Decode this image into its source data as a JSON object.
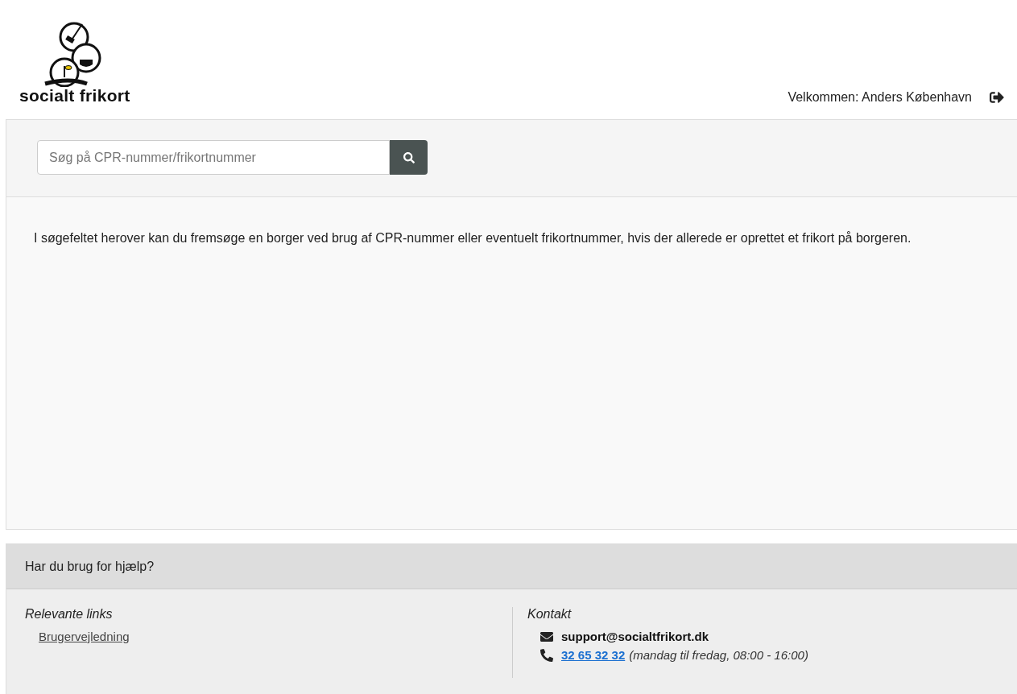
{
  "header": {
    "logo_text": "socialt frikort",
    "welcome": "Velkommen: Anders København"
  },
  "search": {
    "placeholder": "Søg på CPR-nummer/frikortnummer"
  },
  "intro": "I søgefeltet herover kan du fremsøge en borger ved brug af CPR-nummer eller eventuelt frikortnummer, hvis der allerede er oprettet et frikort på borgeren.",
  "help": {
    "title": "Har du brug for hjælp?",
    "links_heading": "Relevante links",
    "links": [
      "Brugervejledning"
    ],
    "contact_heading": "Kontakt",
    "email": "support@socialtfrikort.dk",
    "phone": "32 65 32 32",
    "hours": "(mandag til fredag, 08:00 - 16:00)"
  }
}
